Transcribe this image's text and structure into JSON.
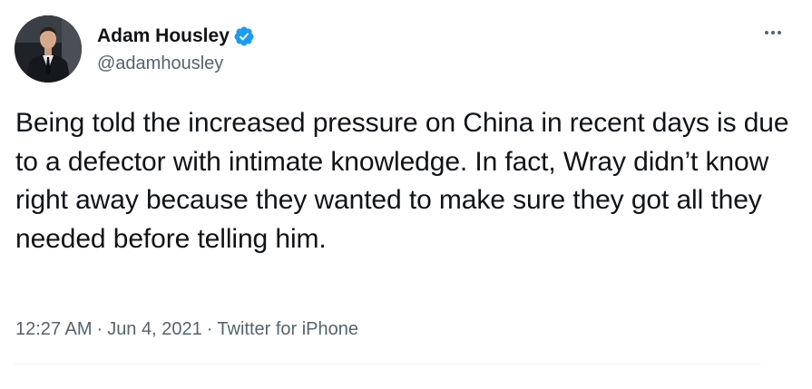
{
  "author": {
    "display_name": "Adam Housley",
    "handle": "@adamhousley",
    "verified": true,
    "avatar_icon": "profile-photo"
  },
  "tweet": {
    "text": "Being told the increased pressure on China in recent days is due to a defector with intimate knowledge. In fact, Wray didn’t know right away because they wanted to make sure they got all they needed before telling him.",
    "time": "12:27 AM",
    "separator": "·",
    "date": "Jun 4, 2021",
    "source": "Twitter for iPhone"
  },
  "menu": {
    "icon": "more-horizontal-icon"
  },
  "colors": {
    "text_primary": "#0f1419",
    "text_secondary": "#536471",
    "verified_blue": "#1d9bf0",
    "divider": "#eff3f4"
  }
}
